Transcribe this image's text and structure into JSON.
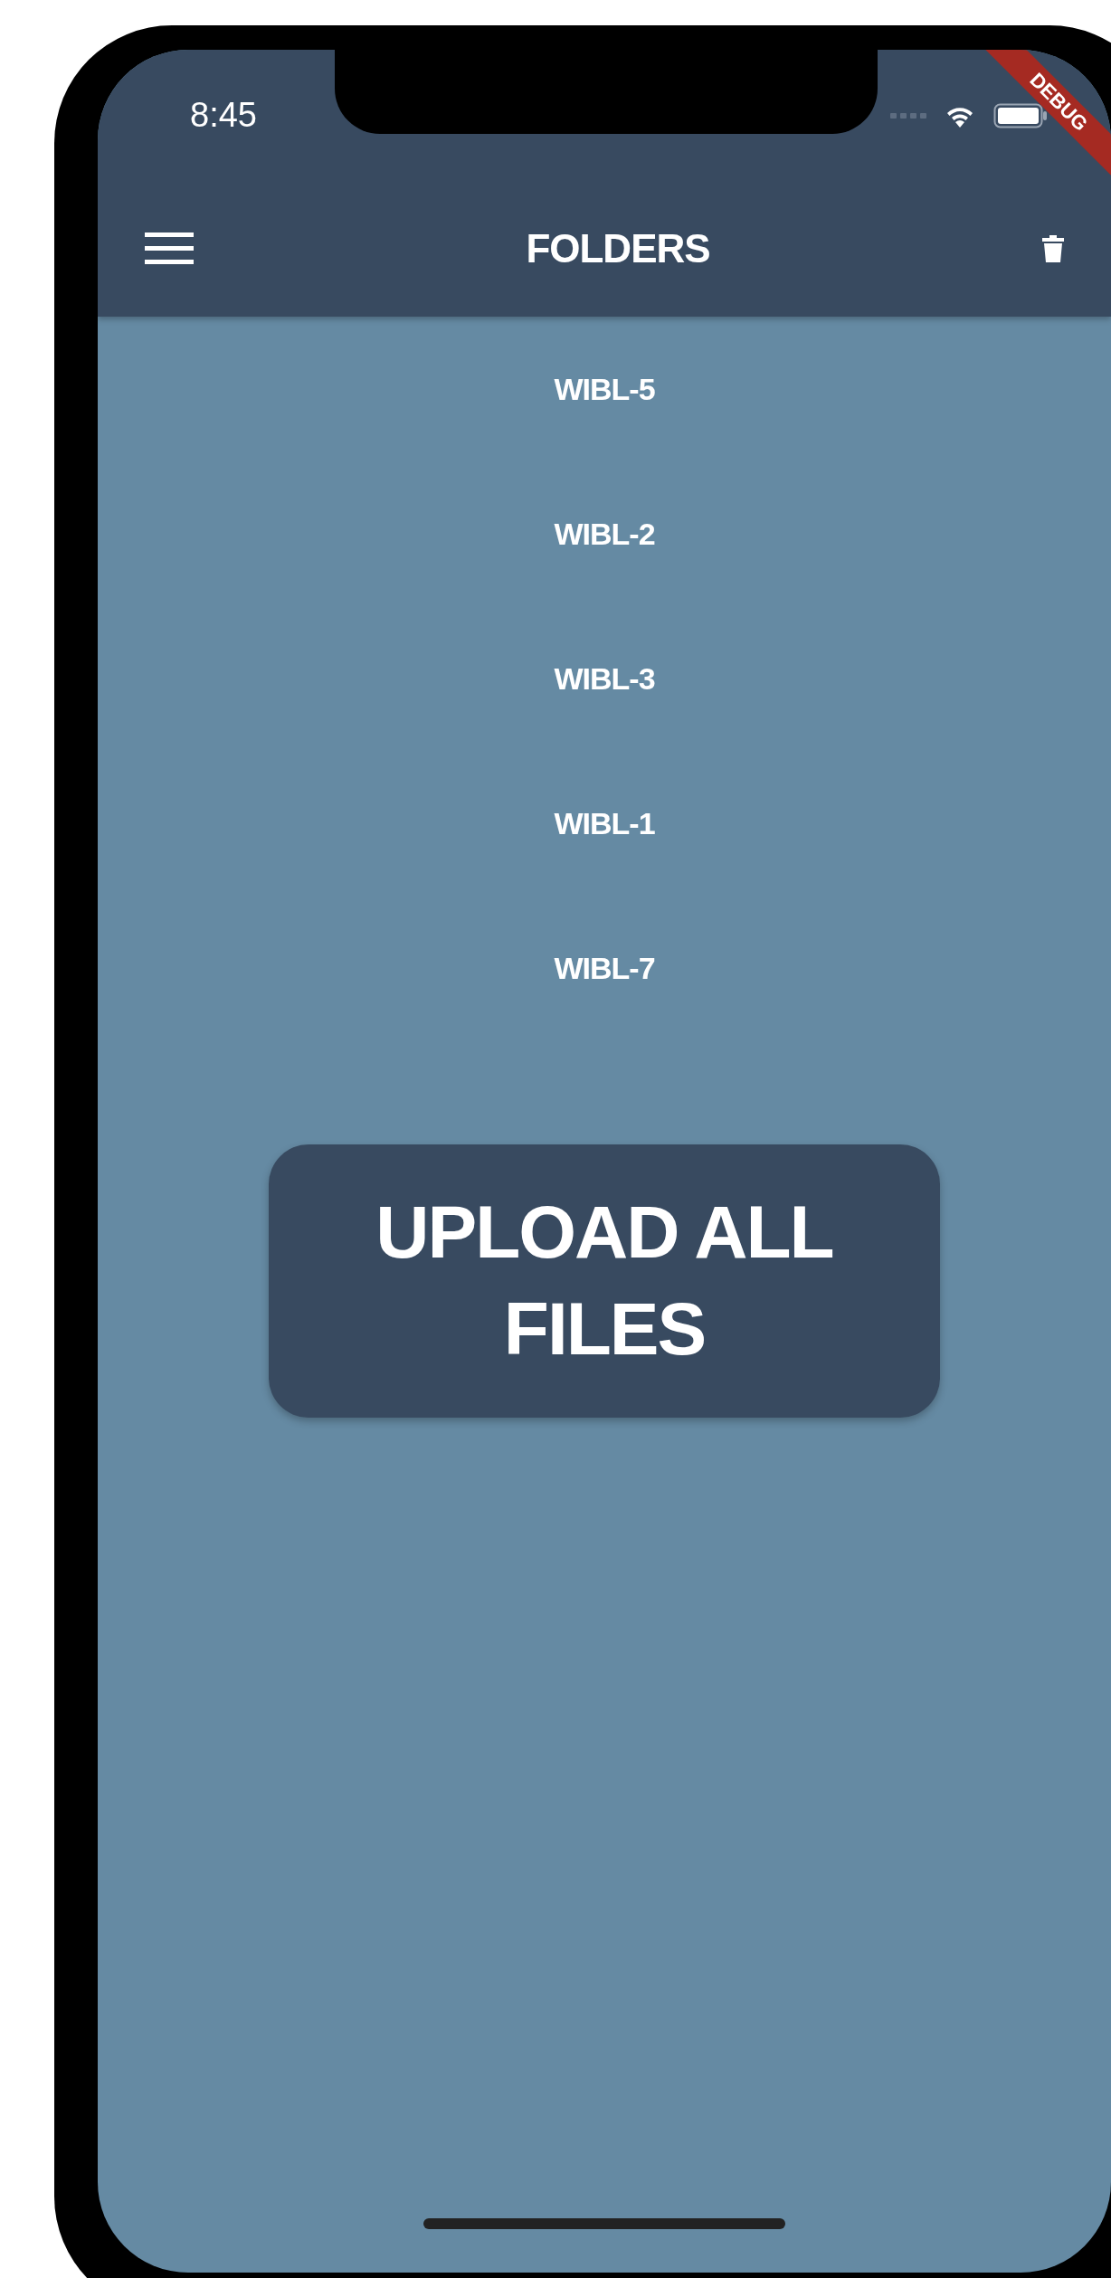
{
  "status_bar": {
    "time": "8:45"
  },
  "debug_banner": "DEBUG",
  "app_bar": {
    "title": "FOLDERS"
  },
  "folders": [
    {
      "name": "WIBL-5"
    },
    {
      "name": "WIBL-2"
    },
    {
      "name": "WIBL-3"
    },
    {
      "name": "WIBL-1"
    },
    {
      "name": "WIBL-7"
    }
  ],
  "upload_button": {
    "label": "UPLOAD ALL FILES"
  }
}
